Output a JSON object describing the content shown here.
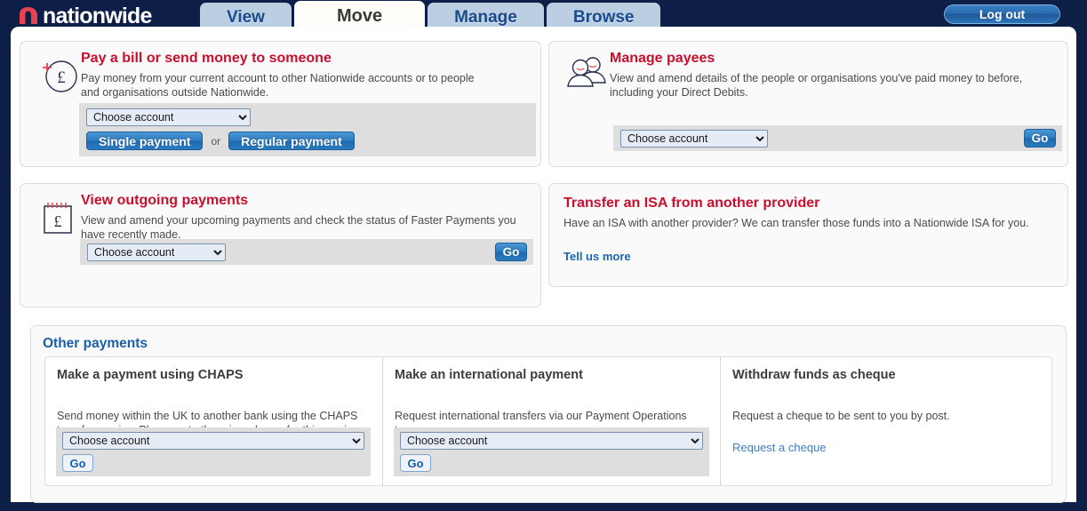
{
  "brand": {
    "name": "nationwide",
    "logo_icon": "nationwide-house-icon"
  },
  "nav": {
    "tabs": [
      {
        "label": "View",
        "active": false
      },
      {
        "label": "Move",
        "active": true
      },
      {
        "label": "Manage",
        "active": false
      },
      {
        "label": "Browse",
        "active": false
      }
    ],
    "logout_label": "Log out"
  },
  "colors": {
    "navy": "#0d1f47",
    "heading_red": "#c8102e",
    "link_blue": "#1a66b3",
    "tab_inactive": "#bccfe2",
    "button_blue": "#2e7cc0",
    "strip_grey": "#dedede"
  },
  "cards": {
    "pay_bill": {
      "icon": "pound-circle-plus-icon",
      "title": "Pay a bill or send money to someone",
      "body": "Pay money from your current account to other Nationwide accounts or to people and organisations outside Nationwide.",
      "select_value": "Choose account",
      "single_label": "Single payment",
      "or_label": "or",
      "regular_label": "Regular payment"
    },
    "manage_payees": {
      "icon": "two-people-icon",
      "title": "Manage payees",
      "body": "View and amend details of the people or organisations you've paid money to before, including your Direct Debits.",
      "select_value": "Choose account",
      "go_label": "Go"
    },
    "view_outgoing": {
      "icon": "notepad-pound-icon",
      "title": "View outgoing payments",
      "body": "View and amend your upcoming payments and check the status of Faster Payments you have recently made.",
      "select_value": "Choose account",
      "go_label": "Go"
    },
    "transfer_isa": {
      "title": "Transfer an ISA from another provider",
      "body": "Have an ISA with another provider? We can transfer those funds into a Nationwide ISA for you.",
      "link_label": "Tell us more"
    }
  },
  "other_payments": {
    "title": "Other payments",
    "columns": [
      {
        "title": "Make a payment using CHAPS",
        "text": "Send money within the UK to another bank using the CHAPS transfer service. Please note there is a charge for this service.",
        "select_value": "Choose account",
        "go_label": "Go"
      },
      {
        "title": "Make an international payment",
        "text": "Request international transfers via our Payment Operations team.",
        "select_value": "Choose account",
        "go_label": "Go"
      },
      {
        "title": "Withdraw funds as cheque",
        "text": "Request a cheque to be sent to you by post.",
        "link_label": "Request a cheque"
      }
    ]
  }
}
